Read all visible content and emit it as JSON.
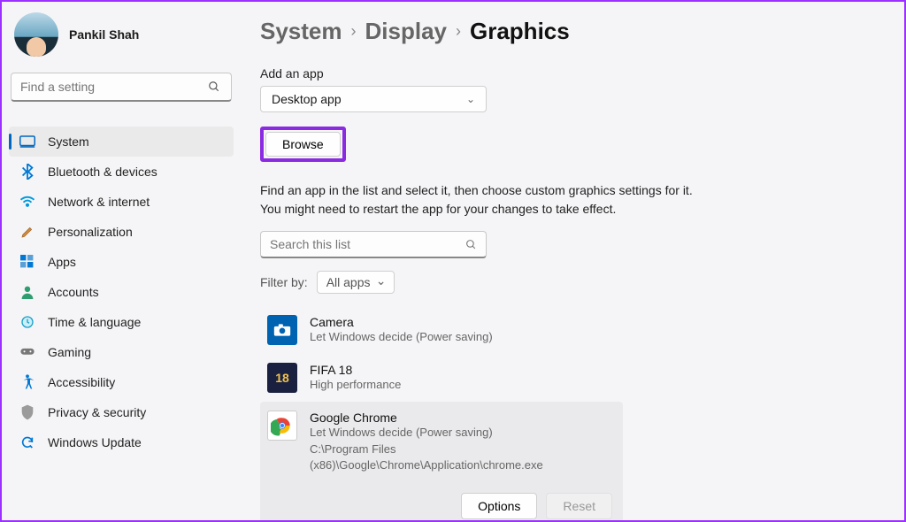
{
  "user": {
    "name": "Pankil Shah"
  },
  "search": {
    "placeholder": "Find a setting"
  },
  "nav": {
    "items": [
      {
        "label": "System"
      },
      {
        "label": "Bluetooth & devices"
      },
      {
        "label": "Network & internet"
      },
      {
        "label": "Personalization"
      },
      {
        "label": "Apps"
      },
      {
        "label": "Accounts"
      },
      {
        "label": "Time & language"
      },
      {
        "label": "Gaming"
      },
      {
        "label": "Accessibility"
      },
      {
        "label": "Privacy & security"
      },
      {
        "label": "Windows Update"
      }
    ]
  },
  "breadcrumb": {
    "root": "System",
    "mid": "Display",
    "current": "Graphics"
  },
  "add_app": {
    "label": "Add an app",
    "dropdown_value": "Desktop app",
    "browse": "Browse"
  },
  "help": "Find an app in the list and select it, then choose custom graphics settings for it. You might need to restart the app for your changes to take effect.",
  "list_search": {
    "placeholder": "Search this list"
  },
  "filter": {
    "label": "Filter by:",
    "value": "All apps"
  },
  "apps": [
    {
      "name": "Camera",
      "sub": "Let Windows decide (Power saving)"
    },
    {
      "name": "FIFA 18",
      "sub": "High performance"
    },
    {
      "name": "Google Chrome",
      "sub": "Let Windows decide (Power saving)",
      "path": "C:\\Program Files (x86)\\Google\\Chrome\\Application\\chrome.exe"
    }
  ],
  "actions": {
    "options": "Options",
    "reset": "Reset"
  }
}
